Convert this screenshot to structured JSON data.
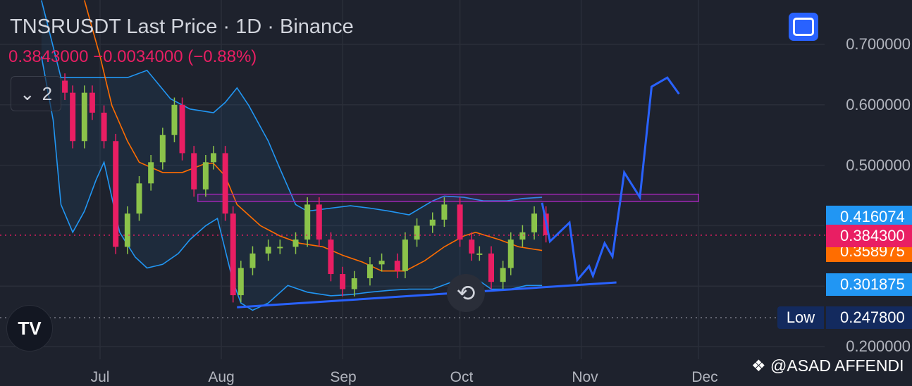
{
  "header": {
    "title": "TNSRUSDT Last Price · 1D · Binance",
    "quote": "0.3843000  −0.0034000 (−0.88%)",
    "indicators_toggle_count": "2"
  },
  "watermark": "@ASAD AFFENDI",
  "icons": {
    "fullscreen": "fullscreen-icon",
    "reset": "reset-chart-icon",
    "logo": "tradingview-logo",
    "chevron": "chevron-down-icon"
  },
  "colors": {
    "up": "#8bc34a",
    "down": "#e91e63",
    "bands": "#2196f3",
    "ma": "#ff6d00",
    "zone": "#9c27b0",
    "drawing": "#2962ff",
    "last_price": "#e91e63"
  },
  "price_tags": {
    "upper_band": "0.416074",
    "last_price": "0.384300",
    "ma": "0.358975",
    "lower_band": "0.301875",
    "low_label": "Low",
    "low": "0.247800"
  },
  "chart_data": {
    "type": "candlestick",
    "symbol": "TNSRUSDT",
    "interval": "1D",
    "exchange": "Binance",
    "y_ticks": [
      "0.700000",
      "0.600000",
      "0.500000",
      "0.200000"
    ],
    "ylim": [
      0.2,
      0.7
    ],
    "x_ticks": [
      "Jul",
      "Aug",
      "Sep",
      "Oct",
      "Nov",
      "Dec"
    ],
    "grid": true,
    "close": [
      [
        "Jun 22",
        0.62
      ],
      [
        "Jun 24",
        0.54
      ],
      [
        "Jun 27",
        0.62
      ],
      [
        "Jun 29",
        0.587
      ],
      [
        "Jul 2",
        0.54
      ],
      [
        "Jul 5",
        0.365
      ],
      [
        "Jul 8",
        0.42
      ],
      [
        "Jul 11",
        0.47
      ],
      [
        "Jul 14",
        0.505
      ],
      [
        "Jul 17",
        0.55
      ],
      [
        "Jul 20",
        0.6
      ],
      [
        "Jul 22",
        0.52
      ],
      [
        "Jul 25",
        0.46
      ],
      [
        "Jul 28",
        0.505
      ],
      [
        "Jul 30",
        0.52
      ],
      [
        "Aug 2",
        0.42
      ],
      [
        "Aug 4",
        0.285
      ],
      [
        "Aug 6",
        0.33
      ],
      [
        "Aug 9",
        0.354
      ],
      [
        "Aug 13",
        0.365
      ],
      [
        "Aug 16",
        0.365
      ],
      [
        "Aug 20",
        0.377
      ],
      [
        "Aug 23",
        0.435
      ],
      [
        "Aug 26",
        0.377
      ],
      [
        "Aug 29",
        0.32
      ],
      [
        "Sep 1",
        0.295
      ],
      [
        "Sep 4",
        0.313
      ],
      [
        "Sep 8",
        0.336
      ],
      [
        "Sep 11",
        0.342
      ],
      [
        "Sep 15",
        0.325
      ],
      [
        "Sep 17",
        0.377
      ],
      [
        "Sep 20",
        0.4
      ],
      [
        "Sep 24",
        0.41
      ],
      [
        "Sep 27",
        0.435
      ],
      [
        "Oct 1",
        0.377
      ],
      [
        "Oct 4",
        0.354
      ],
      [
        "Oct 6",
        0.354
      ],
      [
        "Oct 9",
        0.307
      ],
      [
        "Oct 12",
        0.33
      ],
      [
        "Oct 14",
        0.377
      ],
      [
        "Oct 17",
        0.389
      ],
      [
        "Oct 20",
        0.42
      ],
      [
        "Oct 23",
        0.3843
      ]
    ],
    "upper_band": [
      [
        "Jun 16",
        0.773
      ],
      [
        "Jun 21",
        0.645
      ],
      [
        "Jun 27",
        0.645
      ],
      [
        "Jul 2",
        0.645
      ],
      [
        "Jul 8",
        0.645
      ],
      [
        "Jul 13",
        0.657
      ],
      [
        "Jul 19",
        0.61
      ],
      [
        "Jul 24",
        0.593
      ],
      [
        "Jul 30",
        0.587
      ],
      [
        "Aug 2",
        0.604
      ],
      [
        "Aug 5",
        0.628
      ],
      [
        "Aug 8",
        0.599
      ],
      [
        "Aug 13",
        0.54
      ],
      [
        "Aug 16",
        0.494
      ],
      [
        "Aug 20",
        0.435
      ],
      [
        "Aug 23",
        0.424
      ],
      [
        "Aug 29",
        0.429
      ],
      [
        "Sep 3",
        0.433
      ],
      [
        "Sep 8",
        0.429
      ],
      [
        "Sep 13",
        0.424
      ],
      [
        "Sep 18",
        0.418
      ],
      [
        "Sep 24",
        0.441
      ],
      [
        "Sep 27",
        0.449
      ],
      [
        "Oct 2",
        0.447
      ],
      [
        "Oct 7",
        0.441
      ],
      [
        "Oct 13",
        0.441
      ],
      [
        "Oct 17",
        0.445
      ],
      [
        "Oct 22",
        0.447
      ]
    ],
    "lower_band": [
      [
        "Jun 16",
        0.68
      ],
      [
        "Jun 19",
        0.575
      ],
      [
        "Jun 21",
        0.435
      ],
      [
        "Jun 24",
        0.389
      ],
      [
        "Jun 27",
        0.424
      ],
      [
        "Jun 30",
        0.476
      ],
      [
        "Jul 2",
        0.505
      ],
      [
        "Jul 6",
        0.389
      ],
      [
        "Jul 10",
        0.348
      ],
      [
        "Jul 13",
        0.33
      ],
      [
        "Jul 17",
        0.336
      ],
      [
        "Jul 21",
        0.354
      ],
      [
        "Jul 24",
        0.377
      ],
      [
        "Jul 28",
        0.4
      ],
      [
        "Jul 31",
        0.412
      ],
      [
        "Aug 4",
        0.307
      ],
      [
        "Aug 6",
        0.272
      ],
      [
        "Aug 9",
        0.26
      ],
      [
        "Aug 13",
        0.272
      ],
      [
        "Aug 18",
        0.301
      ],
      [
        "Aug 23",
        0.29
      ],
      [
        "Aug 29",
        0.284
      ],
      [
        "Sep 3",
        0.286
      ],
      [
        "Sep 8",
        0.29
      ],
      [
        "Sep 13",
        0.293
      ],
      [
        "Sep 18",
        0.295
      ],
      [
        "Sep 24",
        0.295
      ],
      [
        "Sep 29",
        0.307
      ],
      [
        "Oct 5",
        0.313
      ],
      [
        "Oct 9",
        0.295
      ],
      [
        "Oct 14",
        0.295
      ],
      [
        "Oct 18",
        0.301
      ],
      [
        "Oct 22",
        0.301
      ]
    ],
    "moving_average": [
      [
        "Jun 27",
        0.773
      ],
      [
        "Jul 1",
        0.68
      ],
      [
        "Jul 4",
        0.599
      ],
      [
        "Jul 8",
        0.54
      ],
      [
        "Jul 11",
        0.505
      ],
      [
        "Jul 17",
        0.488
      ],
      [
        "Jul 22",
        0.488
      ],
      [
        "Jul 28",
        0.503
      ],
      [
        "Jul 30",
        0.503
      ],
      [
        "Aug 2",
        0.482
      ],
      [
        "Aug 5",
        0.435
      ],
      [
        "Aug 11",
        0.4
      ],
      [
        "Aug 16",
        0.383
      ],
      [
        "Aug 21",
        0.371
      ],
      [
        "Aug 27",
        0.365
      ],
      [
        "Sep 1",
        0.351
      ],
      [
        "Sep 6",
        0.34
      ],
      [
        "Sep 11",
        0.325
      ],
      [
        "Sep 17",
        0.325
      ],
      [
        "Sep 22",
        0.342
      ],
      [
        "Sep 27",
        0.365
      ],
      [
        "Oct 2",
        0.383
      ],
      [
        "Oct 5",
        0.389
      ],
      [
        "Oct 11",
        0.377
      ],
      [
        "Oct 16",
        0.365
      ],
      [
        "Oct 22",
        0.359
      ]
    ],
    "drawings": {
      "resistance_zone": {
        "from": "Jul 26",
        "to": "Dec 1",
        "top": 0.452,
        "bottom": 0.44
      },
      "support_trendline": [
        [
          "Aug 5",
          0.265
        ],
        [
          "Nov 10",
          0.306
        ]
      ],
      "projection_path": [
        [
          "Oct 22",
          0.438
        ],
        [
          "Oct 24",
          0.374
        ],
        [
          "Oct 29",
          0.405
        ],
        [
          "Oct 31",
          0.31
        ],
        [
          "Nov 3",
          0.333
        ],
        [
          "Nov 4",
          0.317
        ],
        [
          "Nov 7",
          0.371
        ],
        [
          "Nov 9",
          0.349
        ],
        [
          "Nov 12",
          0.488
        ],
        [
          "Nov 16",
          0.447
        ],
        [
          "Nov 19",
          0.63
        ],
        [
          "Nov 23",
          0.645
        ],
        [
          "Nov 26",
          0.618
        ]
      ]
    },
    "last_price": 0.3843,
    "low": 0.2478
  }
}
